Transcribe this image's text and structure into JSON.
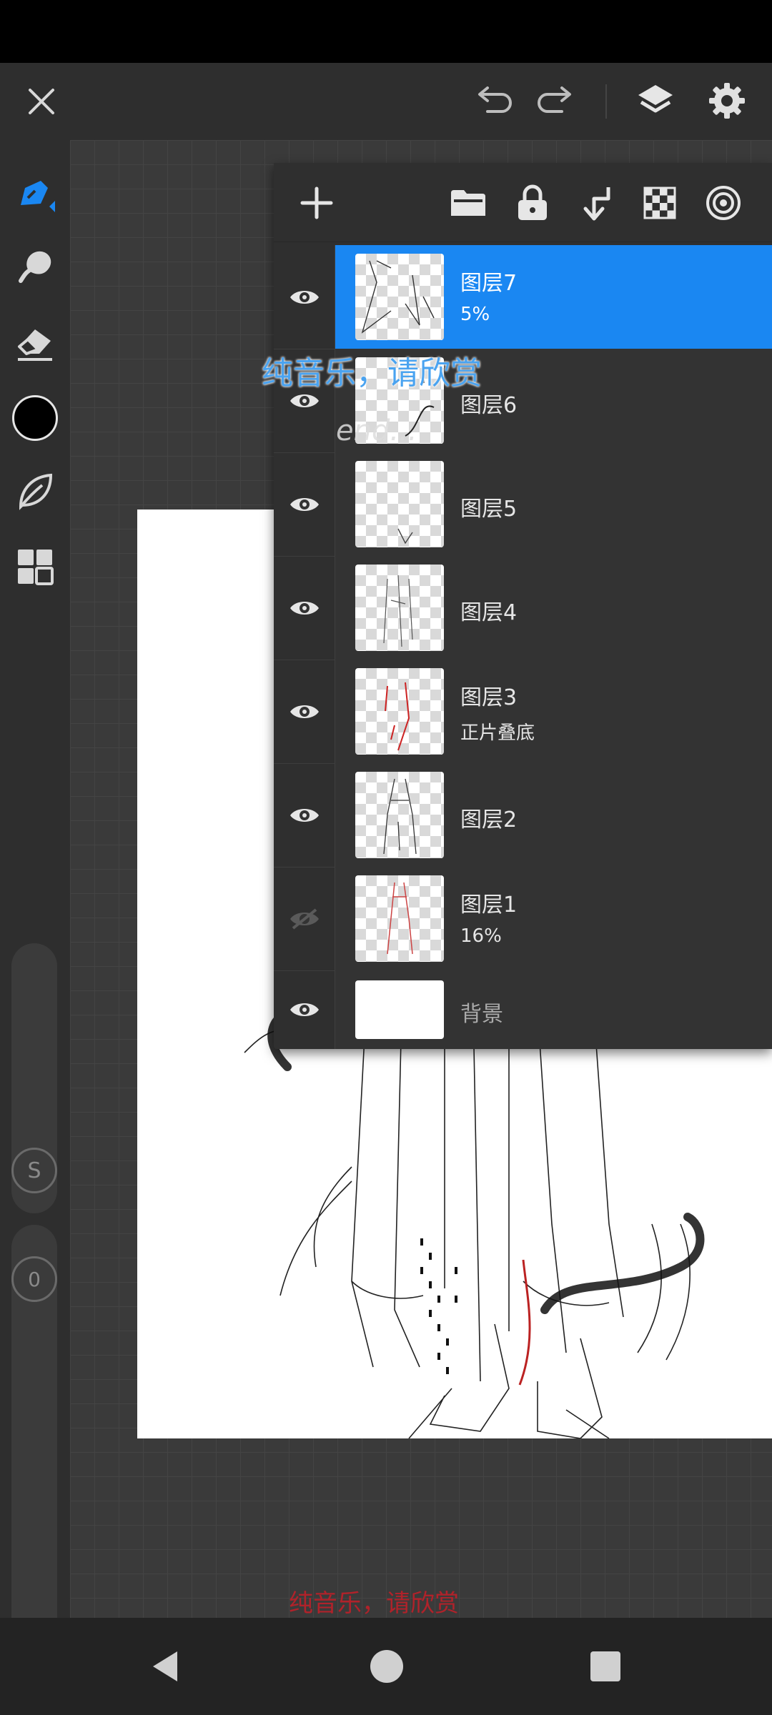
{
  "layers": [
    {
      "name": "图层7",
      "sub": "5%",
      "visible": true,
      "selected": true
    },
    {
      "name": "图层6",
      "sub": "",
      "visible": true,
      "selected": false
    },
    {
      "name": "图层5",
      "sub": "",
      "visible": true,
      "selected": false
    },
    {
      "name": "图层4",
      "sub": "",
      "visible": true,
      "selected": false
    },
    {
      "name": "图层3",
      "sub": "正片叠底",
      "visible": true,
      "selected": false
    },
    {
      "name": "图层2",
      "sub": "",
      "visible": true,
      "selected": false
    },
    {
      "name": "图层1",
      "sub": "16%",
      "visible": false,
      "selected": false
    },
    {
      "name": "背景",
      "sub": "",
      "visible": true,
      "selected": false
    }
  ],
  "overlay": {
    "caption_blue": "纯音乐，请欣赏",
    "caption_end": "end...",
    "caption_red": "纯音乐，请欣赏"
  },
  "tools": {
    "size_label": "S",
    "opacity_label": "0"
  },
  "colors": {
    "accent": "#1a87f2",
    "brush_color": "#000000"
  }
}
